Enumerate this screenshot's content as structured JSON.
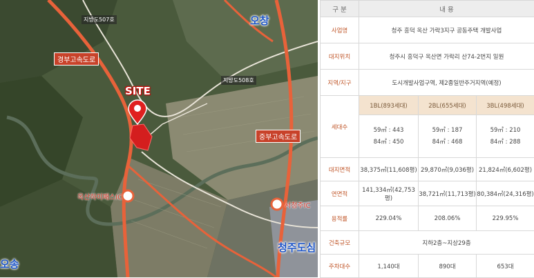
{
  "map": {
    "site_label": "SITE",
    "labels": {
      "local_road_507": "지방도507호",
      "local_road_508": "지방도508호",
      "gyeongbu_expressway": "경부고속도로",
      "jungbu_expressway": "중부고속도로",
      "ochang": "오창",
      "cheongju_doshim": "청주도심",
      "osong": "오송",
      "oksan_ic": "옥산하이패스IC",
      "seochang_ic": "서청주IC"
    }
  },
  "table": {
    "header": {
      "category": "구  분",
      "content": "내  용"
    },
    "rows": {
      "project_name": {
        "label": "사업명",
        "value": "청주 흥덕 옥산 가락3지구 공동주택 개발사업"
      },
      "location": {
        "label": "대지위치",
        "value": "청주시 흥덕구 옥산면 가락리 산74-2번지 일원"
      },
      "zoning": {
        "label": "지역/지구",
        "value": "도시개발사업구역, 제2종일반주거지역(예정)"
      },
      "households": {
        "label": "세대수",
        "blocks": [
          {
            "name": "1BL(893세대)",
            "line1": "59㎡ : 443",
            "line2": "84㎡ : 450"
          },
          {
            "name": "2BL(655세대)",
            "line1": "59㎡ : 187",
            "line2": "84㎡ : 468"
          },
          {
            "name": "3BL(498세대)",
            "line1": "59㎡ : 210",
            "line2": "84㎡ : 288"
          }
        ]
      },
      "site_area": {
        "label": "대지면적",
        "values": [
          "38,375㎡(11,608평)",
          "29,870㎡(9,036평)",
          "21,824㎡(6,602평)"
        ]
      },
      "floor_area": {
        "label": "연면적",
        "values": [
          "141,334㎡(42,753평)",
          "38,721㎡(11,713평)",
          "80,384㎡(24,316평)"
        ]
      },
      "far": {
        "label": "용적률",
        "values": [
          "229.04%",
          "208.06%",
          "229.95%"
        ]
      },
      "building_scale": {
        "label": "건축규모",
        "value": "지하2층~지상29층"
      },
      "parking": {
        "label": "주차대수",
        "values": [
          "1,140대",
          "890대",
          "653대"
        ]
      }
    }
  },
  "colors": {
    "road": "#e8623a",
    "site": "#d41e1e",
    "label_bg": "#c8422a",
    "header_bg": "#ededed",
    "subheader_bg": "#f4e3cf",
    "accent_text": "#c0572a"
  }
}
